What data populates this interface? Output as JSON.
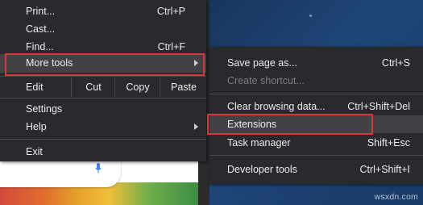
{
  "main_menu": {
    "print": {
      "label": "Print...",
      "shortcut": "Ctrl+P"
    },
    "cast": {
      "label": "Cast..."
    },
    "find": {
      "label": "Find...",
      "shortcut": "Ctrl+F"
    },
    "more_tools": {
      "label": "More tools"
    },
    "edit": {
      "label": "Edit",
      "cut": "Cut",
      "copy": "Copy",
      "paste": "Paste"
    },
    "settings": {
      "label": "Settings"
    },
    "help": {
      "label": "Help"
    },
    "exit": {
      "label": "Exit"
    }
  },
  "more_tools_submenu": {
    "items": [
      {
        "label": "Save page as...",
        "shortcut": "Ctrl+S",
        "enabled": true
      },
      {
        "label": "Create shortcut...",
        "shortcut": "",
        "enabled": false
      },
      {
        "label": "Clear browsing data...",
        "shortcut": "Ctrl+Shift+Del",
        "enabled": true
      },
      {
        "label": "Extensions",
        "shortcut": "",
        "enabled": true,
        "highlighted": true
      },
      {
        "label": "Task manager",
        "shortcut": "Shift+Esc",
        "enabled": true
      },
      {
        "label": "Developer tools",
        "shortcut": "Ctrl+Shift+I",
        "enabled": true
      }
    ]
  },
  "watermark": "wsxdn.com",
  "colors": {
    "menu_bg": "#292a2d",
    "hover_bg": "#414246",
    "highlight_border": "#d23a3a",
    "desktop_bg": "#1e3a62"
  }
}
